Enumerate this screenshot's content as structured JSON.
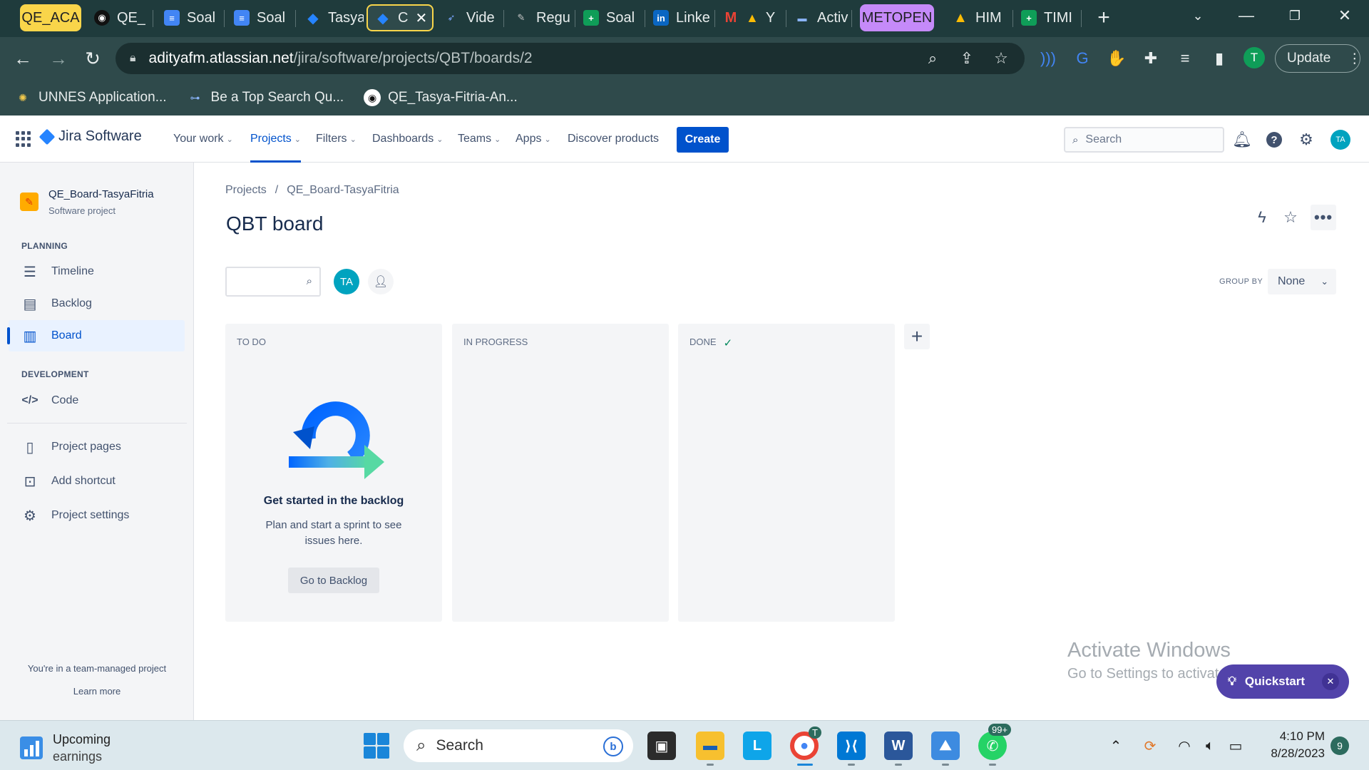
{
  "browser": {
    "tabs": [
      {
        "label": "QE_ACA",
        "icon": "tab-group-label"
      },
      {
        "label": "QE_T",
        "icon": "github-icon"
      },
      {
        "label": "Soal",
        "icon": "google-docs-icon"
      },
      {
        "label": "Soal",
        "icon": "google-docs-icon"
      },
      {
        "label": "Tasya",
        "icon": "jira-icon"
      },
      {
        "label": "C",
        "icon": "jira-icon"
      },
      {
        "label": "Vide",
        "icon": "video-icon"
      },
      {
        "label": "Regu",
        "icon": "tool-icon"
      },
      {
        "label": "Soal",
        "icon": "google-sheets-icon"
      },
      {
        "label": "Linke",
        "icon": "linkedin-icon"
      },
      {
        "label": "Y",
        "icon": "gmail-icon"
      },
      {
        "label": "Activ",
        "icon": "activity-icon"
      },
      {
        "label": "METOPEN",
        "icon": "tab-group-label"
      },
      {
        "label": "HIM",
        "icon": "google-drive-icon"
      },
      {
        "label": "TIMI",
        "icon": "google-sheets-icon"
      }
    ],
    "url_host": "adityafm.atlassian.net",
    "url_path": "/jira/software/projects/QBT/boards/2",
    "profile_initial": "T",
    "update_label": "Update",
    "bookmarks": [
      {
        "label": "UNNES Application...",
        "icon": "unnes-icon"
      },
      {
        "label": "Be a Top Search Qu...",
        "icon": "search-quality-icon"
      },
      {
        "label": "QE_Tasya-Fitria-An...",
        "icon": "github-icon"
      }
    ]
  },
  "jira": {
    "logo_text": "Jira Software",
    "nav": {
      "your_work": "Your work",
      "projects": "Projects",
      "filters": "Filters",
      "dashboards": "Dashboards",
      "teams": "Teams",
      "apps": "Apps",
      "discover": "Discover products",
      "create": "Create"
    },
    "search_placeholder": "Search",
    "user_initials": "TA",
    "sidebar": {
      "project_name": "QE_Board-TasyaFitria",
      "project_type": "Software project",
      "planning_label": "PLANNING",
      "timeline": "Timeline",
      "backlog": "Backlog",
      "board": "Board",
      "development_label": "DEVELOPMENT",
      "code": "Code",
      "project_pages": "Project pages",
      "add_shortcut": "Add shortcut",
      "project_settings": "Project settings",
      "team_note": "You're in a team-managed project",
      "learn_more": "Learn more"
    },
    "breadcrumb": {
      "root": "Projects",
      "sep": "/",
      "project": "QE_Board-TasyaFitria"
    },
    "page_title": "QBT board",
    "toolbar": {
      "avatar_initials": "TA",
      "group_by_label": "GROUP BY",
      "group_by_value": "None"
    },
    "columns": [
      {
        "title": "TO DO"
      },
      {
        "title": "IN PROGRESS"
      },
      {
        "title": "DONE",
        "done": true
      }
    ],
    "empty_state": {
      "title": "Get started in the backlog",
      "description": "Plan and start a sprint to see issues here.",
      "button": "Go to Backlog"
    },
    "quickstart": "Quickstart",
    "watermark": {
      "title": "Activate Windows",
      "subtitle": "Go to Settings to activate Windows."
    }
  },
  "taskbar": {
    "widget_line1": "Upcoming",
    "widget_line2": "earnings",
    "search_placeholder": "Search",
    "chrome_badge": "T",
    "whatsapp_badge": "99+",
    "time": "4:10 PM",
    "date": "8/28/2023",
    "notification_count": "9"
  },
  "colors": {
    "jira_blue": "#0052cc",
    "chrome_frame": "#1f3b3c",
    "quickstart_purple": "#5243aa",
    "done_green": "#00875a"
  }
}
